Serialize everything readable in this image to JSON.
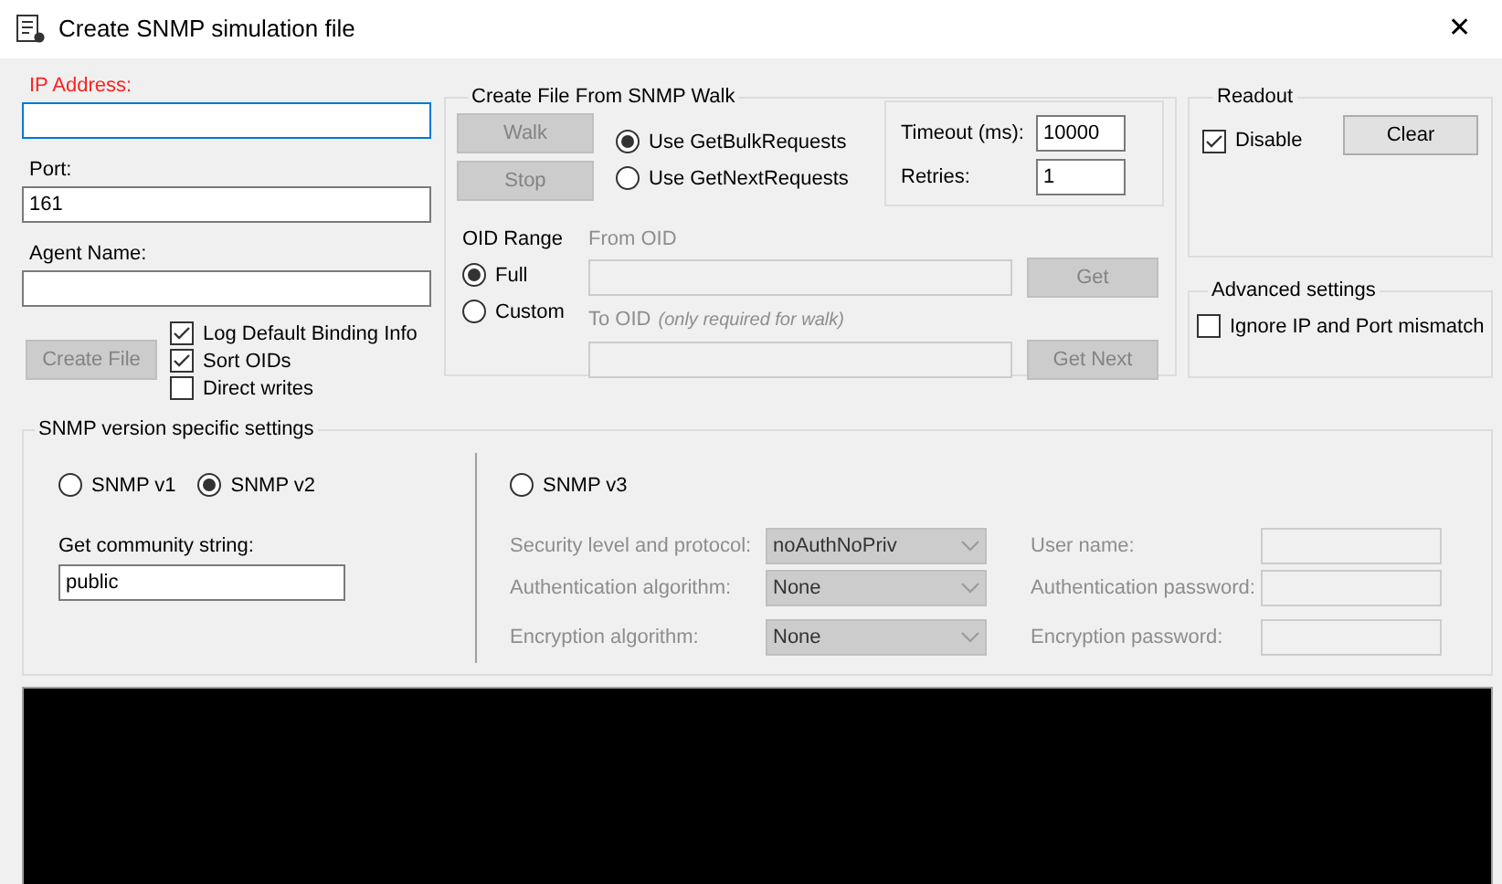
{
  "window": {
    "title": "Create SNMP simulation file",
    "close_glyph": "✕"
  },
  "ip_address": {
    "label": "IP Address:",
    "invalid": true,
    "focused": true
  },
  "port": {
    "label": "Port:",
    "value": "161"
  },
  "agent_name": {
    "label": "Agent Name:"
  },
  "create_file_button": {
    "label": "Create File",
    "disabled": true
  },
  "options": [
    {
      "label": "Log Default Binding Info",
      "checked": true
    },
    {
      "label": "Sort OIDs",
      "checked": true
    },
    {
      "label": "Direct writes",
      "checked": false
    }
  ],
  "walk": {
    "title": "Create File From SNMP Walk",
    "buttons": [
      {
        "label": "Walk",
        "disabled": true
      },
      {
        "label": "Stop",
        "disabled": true
      }
    ],
    "request_modes": [
      {
        "label": "Use GetBulkRequests",
        "selected": true
      },
      {
        "label": "Use GetNextRequests",
        "selected": false
      }
    ],
    "timeout": {
      "label": "Timeout (ms):",
      "value": "10000"
    },
    "retries": {
      "label": "Retries:",
      "value": "1"
    },
    "oid_range": {
      "label": "OID Range",
      "options": [
        {
          "label": "Full",
          "selected": true
        },
        {
          "label": "Custom",
          "selected": false
        }
      ]
    },
    "from_oid": {
      "label": "From OID",
      "disabled": true,
      "button": {
        "label": "Get",
        "disabled": true
      }
    },
    "to_oid": {
      "label": "To OID",
      "hint": "(only required for walk)",
      "disabled": true,
      "button": {
        "label": "Get Next",
        "disabled": true
      }
    }
  },
  "readout": {
    "title": "Readout",
    "disable": {
      "label": "Disable",
      "checked": true
    },
    "clear_button": {
      "label": "Clear",
      "disabled": false
    }
  },
  "advanced": {
    "title": "Advanced settings",
    "ignore_mismatch": {
      "label": "Ignore IP and Port mismatch",
      "checked": false
    }
  },
  "version": {
    "title": "SNMP version specific settings",
    "versions": [
      {
        "label": "SNMP v1",
        "selected": false
      },
      {
        "label": "SNMP v2",
        "selected": true
      },
      {
        "label": "SNMP v3",
        "selected": false
      }
    ],
    "community": {
      "label": "Get community string:",
      "value": "public"
    },
    "v3_settings": [
      {
        "label": "Security level and protocol:",
        "value": "noAuthNoPriv",
        "disabled": true
      },
      {
        "label": "Authentication algorithm:",
        "value": "None",
        "disabled": true
      },
      {
        "label": "Encryption algorithm:",
        "value": "None",
        "disabled": true
      }
    ],
    "v3_credentials": [
      {
        "label": "User name:",
        "disabled": true
      },
      {
        "label": "Authentication password:",
        "disabled": true
      },
      {
        "label": "Encryption password:",
        "disabled": true
      }
    ]
  }
}
